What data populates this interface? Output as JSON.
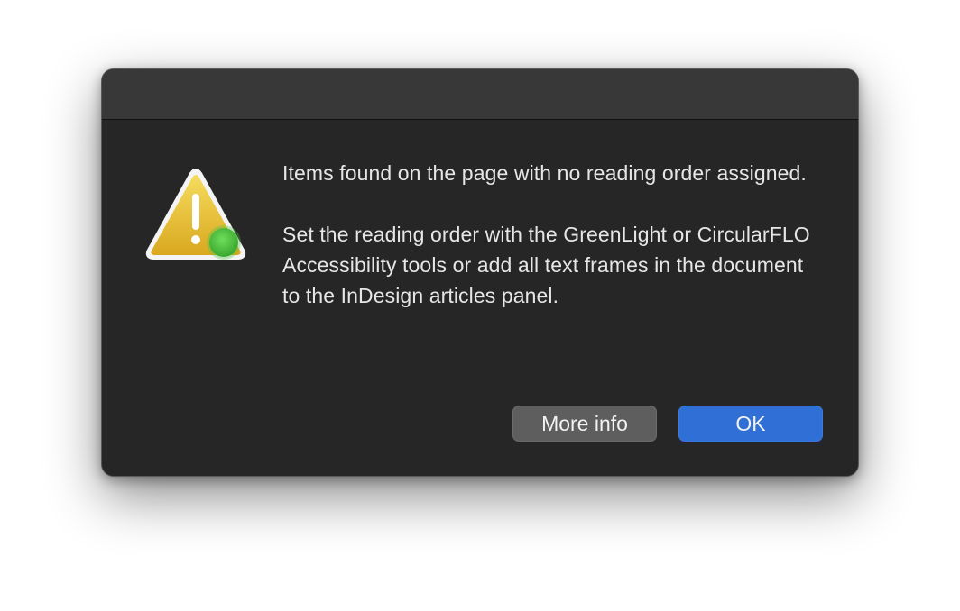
{
  "dialog": {
    "message_primary": "Items found on the page with no reading order assigned.",
    "message_secondary": "Set the reading order with the GreenLight or CircularFLO Accessibility tools or add all text frames in the document to the InDesign articles panel.",
    "icon": "warning-triangle-icon",
    "badge_icon": "green-status-dot-icon",
    "buttons": {
      "more_info_label": "More info",
      "ok_label": "OK"
    }
  },
  "colors": {
    "dialog_background": "#262626",
    "titlebar": "#383838",
    "ok_button": "#2f6fd6",
    "more_info_button": "#5e5e5e",
    "warning_yellow": "#e8bd2e",
    "badge_green": "#4cc23e"
  }
}
